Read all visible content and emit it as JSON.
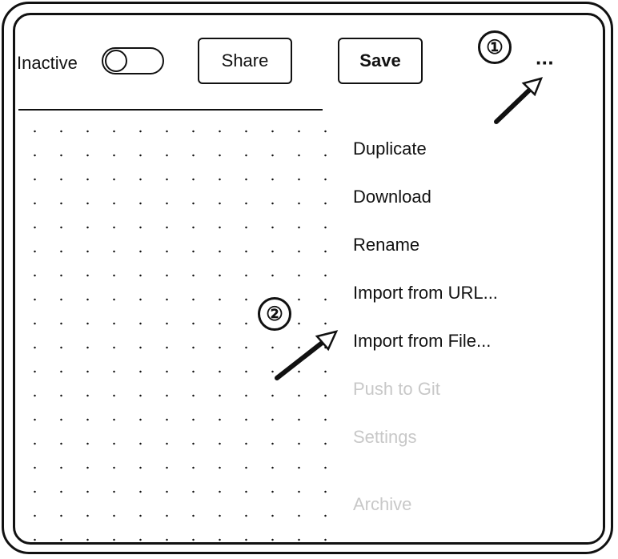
{
  "toolbar": {
    "status_label": "Inactive",
    "share_label": "Share",
    "save_label": "Save",
    "more_label": "···"
  },
  "menu": {
    "items": [
      {
        "label": "Duplicate",
        "enabled": true
      },
      {
        "label": "Download",
        "enabled": true
      },
      {
        "label": "Rename",
        "enabled": true
      },
      {
        "label": "Import from URL...",
        "enabled": true
      },
      {
        "label": "Import from File...",
        "enabled": true
      },
      {
        "label": "Push to Git",
        "enabled": false
      },
      {
        "label": "Settings",
        "enabled": false
      },
      {
        "label": "Archive",
        "enabled": false
      }
    ]
  },
  "annotations": {
    "step1": "①",
    "step2": "②"
  }
}
